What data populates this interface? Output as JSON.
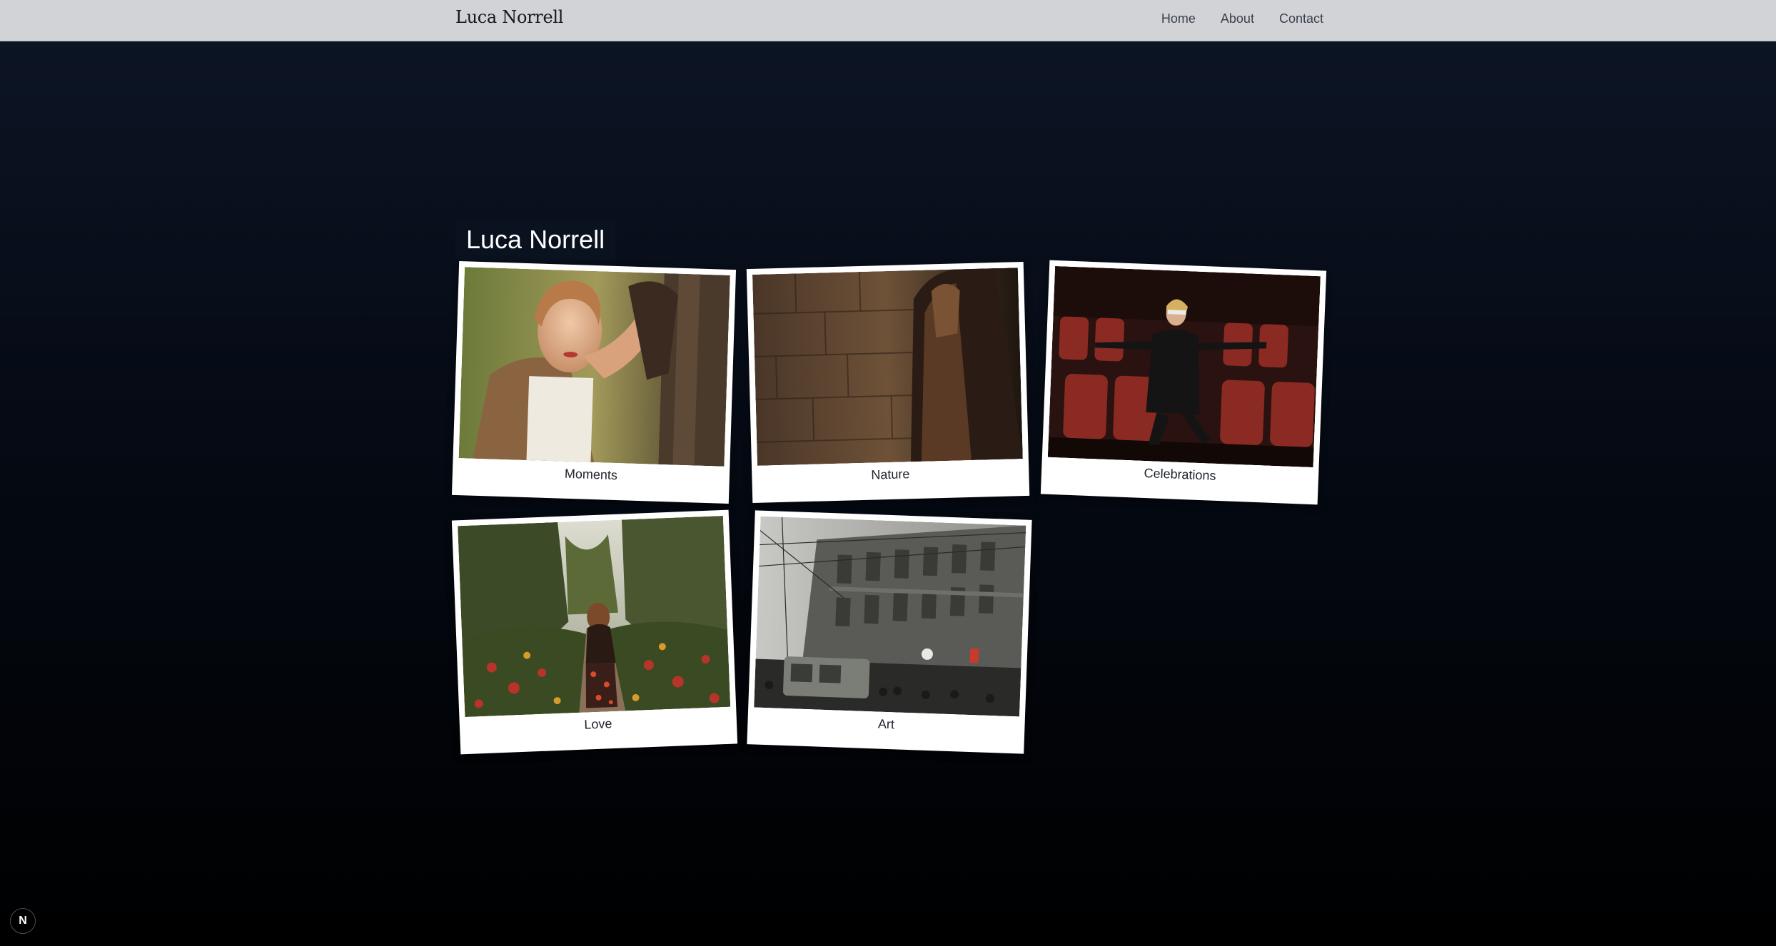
{
  "nav": {
    "brand": "Luca Norrell",
    "links": [
      "Home",
      "About",
      "Contact"
    ]
  },
  "hero": {
    "title": "Luca Norrell"
  },
  "gallery": {
    "cards": [
      {
        "label": "Moments"
      },
      {
        "label": "Nature"
      },
      {
        "label": "Celebrations"
      },
      {
        "label": "Love"
      },
      {
        "label": "Art"
      }
    ]
  },
  "badge": {
    "letter": "N",
    "icon": "nextjs-icon"
  },
  "colors": {
    "navbar": "#d1d3d7",
    "background_top": "#0d1626",
    "background_bottom": "#000000",
    "card": "#ffffff"
  }
}
